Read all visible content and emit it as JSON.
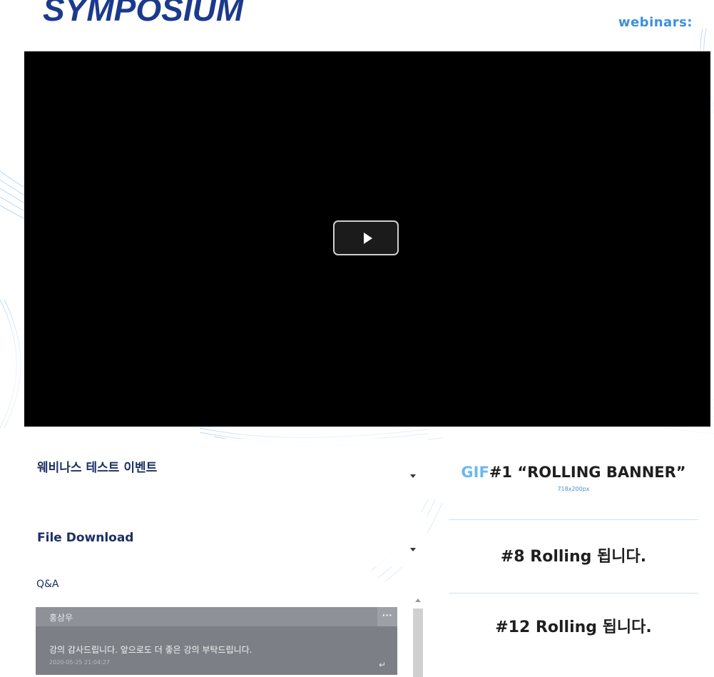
{
  "header": {
    "logo_text": "SYMPOSIUM",
    "brand_text": "webinars",
    "brand_suffix": ":"
  },
  "video": {
    "play_label": "Play video"
  },
  "event_info": {
    "title": "웨비나스 테스트 이벤트"
  },
  "file_download": {
    "title": "File Download"
  },
  "qa": {
    "label": "Q&A",
    "messages": [
      {
        "author": "홍상우",
        "text": "강의 감사드립니다. 앞으로도 더 좋은 강의 부탁드립니다.",
        "timestamp": "2020-05-25 21:04:27",
        "more_symbol": "···",
        "reply_symbol": "↵"
      }
    ]
  },
  "banners": [
    {
      "tag": "GIF",
      "text": "#1 “ROLLING BANNER”",
      "size": "718x200px"
    },
    {
      "text": "#8 Rolling 됩니다."
    },
    {
      "text": "#12 Rolling 됩니다."
    }
  ],
  "colors": {
    "logo": "#1c3a8c",
    "brand": "#3b8fe0",
    "heading": "#1d2f66",
    "qa_box": "#7c7f85",
    "gif_tag": "#6cb8f0",
    "video_bg": "#000000"
  }
}
